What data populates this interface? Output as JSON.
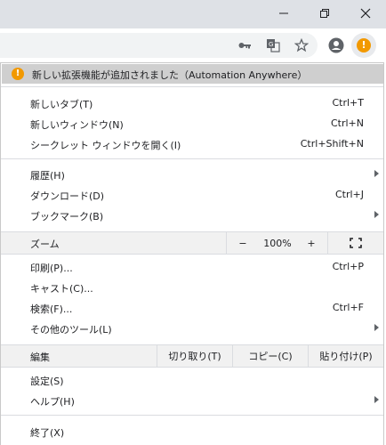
{
  "banner": {
    "text": "新しい拡張機能が追加されました（Automation Anywhere）",
    "icon": "warning-icon",
    "icon_glyph": "!"
  },
  "window_controls": {
    "minimize": "minimize-icon",
    "maximize": "restore-icon",
    "close": "close-icon"
  },
  "toolbar": {
    "icons": [
      "key-icon",
      "translate-icon",
      "star-icon",
      "profile-icon",
      "alert-menu-icon"
    ]
  },
  "menu": {
    "group1": [
      {
        "label": "新しいタブ(T)",
        "shortcut": "Ctrl+T"
      },
      {
        "label": "新しいウィンドウ(N)",
        "shortcut": "Ctrl+N"
      },
      {
        "label": "シークレット ウィンドウを開く(I)",
        "shortcut": "Ctrl+Shift+N"
      }
    ],
    "group2": [
      {
        "label": "履歴(H)",
        "submenu": true
      },
      {
        "label": "ダウンロード(D)",
        "shortcut": "Ctrl+J"
      },
      {
        "label": "ブックマーク(B)",
        "submenu": true
      }
    ],
    "zoom": {
      "label": "ズーム",
      "minus": "−",
      "value": "100%",
      "plus": "+",
      "fullscreen_icon": "fullscreen-icon"
    },
    "group3": [
      {
        "label": "印刷(P)...",
        "shortcut": "Ctrl+P"
      },
      {
        "label": "キャスト(C)..."
      },
      {
        "label": "検索(F)...",
        "shortcut": "Ctrl+F"
      },
      {
        "label": "その他のツール(L)",
        "submenu": true
      }
    ],
    "edit": {
      "label": "編集",
      "cut": "切り取り(T)",
      "copy": "コピー(C)",
      "paste": "貼り付け(P)"
    },
    "group4": [
      {
        "label": "設定(S)"
      },
      {
        "label": "ヘルプ(H)",
        "submenu": true
      }
    ],
    "group5": [
      {
        "label": "終了(X)"
      }
    ]
  },
  "colors": {
    "accent_orange": "#f29900",
    "banner_bg": "#cfcfcf",
    "titlebar_bg": "#dee1e6"
  }
}
